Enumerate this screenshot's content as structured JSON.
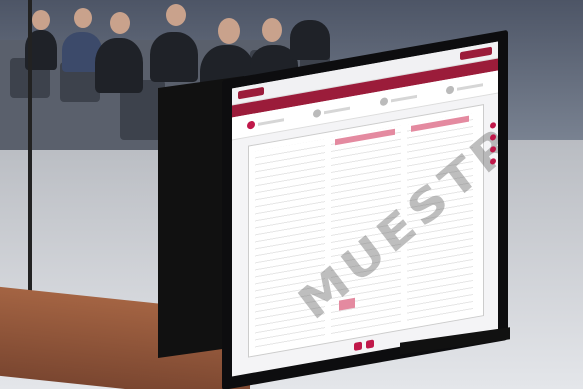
{
  "watermark": "MUESTRA"
}
